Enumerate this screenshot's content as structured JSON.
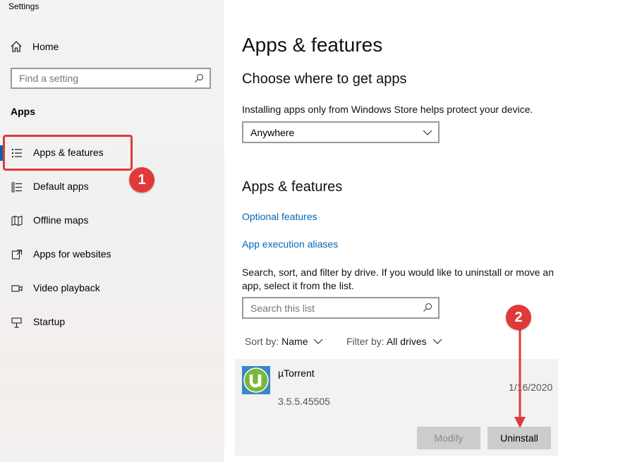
{
  "window": {
    "title": "Settings"
  },
  "sidebar": {
    "home_label": "Home",
    "search_placeholder": "Find a setting",
    "section_label": "Apps",
    "items": [
      {
        "label": "Apps & features",
        "icon": "list-icon",
        "selected": true
      },
      {
        "label": "Default apps",
        "icon": "default-apps-icon"
      },
      {
        "label": "Offline maps",
        "icon": "map-icon"
      },
      {
        "label": "Apps for websites",
        "icon": "link-window-icon"
      },
      {
        "label": "Video playback",
        "icon": "video-icon"
      },
      {
        "label": "Startup",
        "icon": "startup-icon"
      }
    ]
  },
  "annotations": {
    "badge1": "1",
    "badge2": "2",
    "highlight_color": "#e0393a"
  },
  "main": {
    "title": "Apps & features",
    "choose_heading": "Choose where to get apps",
    "choose_desc": "Installing apps only from Windows Store helps protect your device.",
    "source_dropdown": "Anywhere",
    "apps_heading": "Apps & features",
    "optional_link": "Optional features",
    "aliases_link": "App execution aliases",
    "list_desc_line1": "Search, sort, and filter by drive. If you would like to uninstall or move an",
    "list_desc_line2": "app, select it from the list.",
    "list_search_placeholder": "Search this list",
    "sort_key": "Sort by:",
    "sort_value": "Name",
    "filter_key": "Filter by:",
    "filter_value": "All drives",
    "app": {
      "name": "µTorrent",
      "version": "3.5.5.45505",
      "date": "1/16/2020",
      "modify_label": "Modify",
      "uninstall_label": "Uninstall"
    }
  },
  "colors": {
    "accent": "#0063b1",
    "link": "#0067b8",
    "annotation": "#e0393a"
  }
}
